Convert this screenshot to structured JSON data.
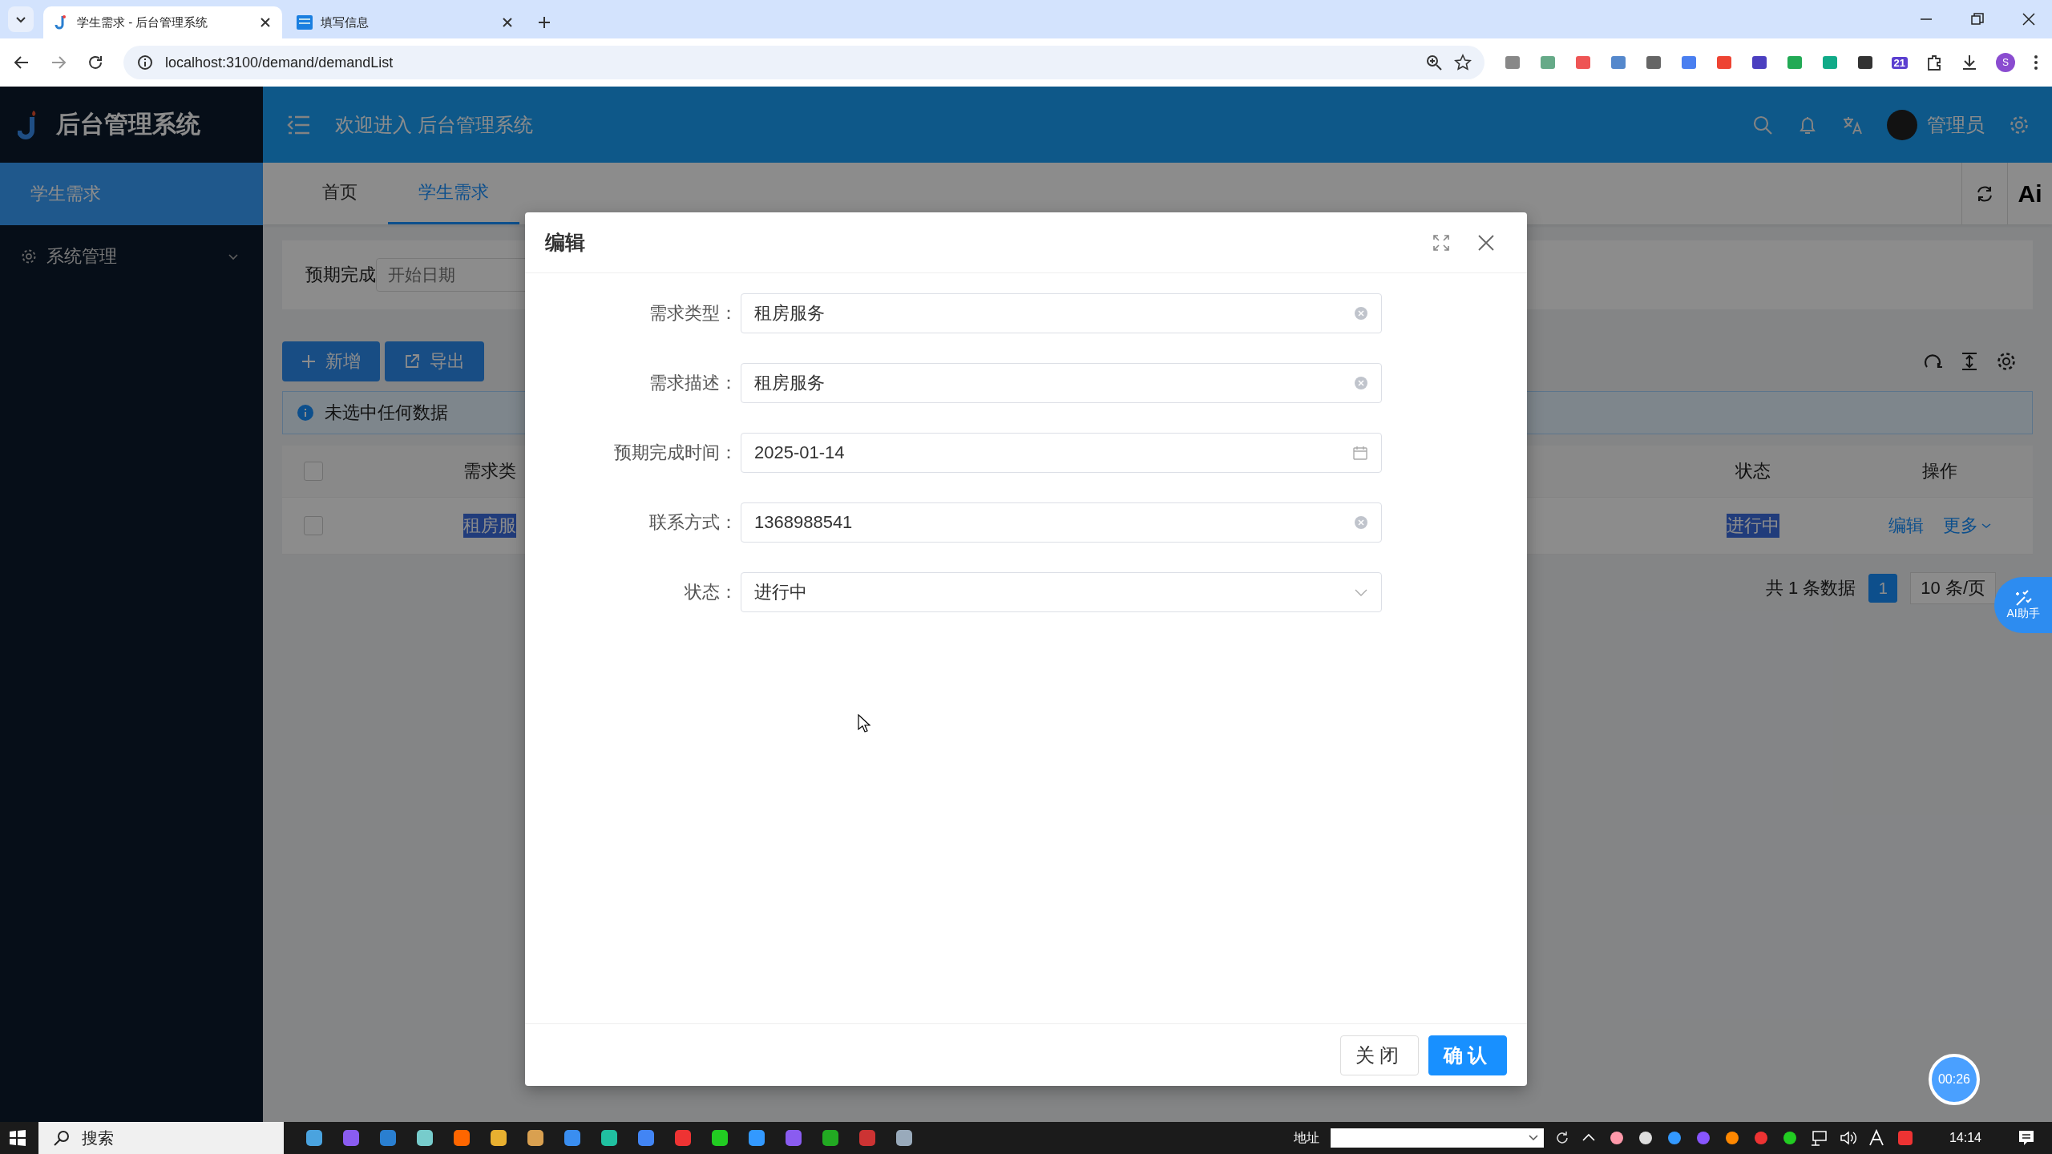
{
  "browser": {
    "tabs": [
      {
        "title": "学生需求 - 后台管理系统",
        "selected": true
      },
      {
        "title": "填写信息",
        "selected": false
      }
    ],
    "address": "localhost:3100/demand/demandList",
    "profile": "S",
    "badge": "21"
  },
  "sidebar": {
    "brand": "后台管理系统",
    "items": [
      {
        "label": "学生需求",
        "kind": "link",
        "selected": true
      },
      {
        "label": "系统管理",
        "kind": "group",
        "selected": false,
        "expanded": false
      }
    ]
  },
  "header": {
    "welcome": "欢迎进入 后台管理系统",
    "user": "管理员"
  },
  "tabs": [
    {
      "label": "首页",
      "selected": false
    },
    {
      "label": "学生需求",
      "selected": true
    }
  ],
  "tabs_extra": "Ai",
  "filter": {
    "label": "预期完成",
    "placeholder": "开始日期"
  },
  "toolbar": {
    "buttons": [
      {
        "label": "新增",
        "kind": "add"
      },
      {
        "label": "导出",
        "kind": "export"
      }
    ]
  },
  "alert": "未选中任何数据",
  "table": {
    "select_all": {
      "checked": false
    },
    "columns": [
      "需求类",
      "状态",
      "操作"
    ],
    "rows": [
      {
        "checked": false,
        "type": {
          "text": "租房服",
          "highlighted": true
        },
        "status": {
          "text": "进行中",
          "highlighted": true
        },
        "actions": [
          {
            "label": "编辑",
            "kind": "link"
          },
          {
            "label": "更多",
            "kind": "menu"
          }
        ]
      }
    ]
  },
  "pagination": {
    "total": "共 1 条数据",
    "pages": [
      {
        "label": "1",
        "selected": true
      }
    ],
    "page_size": "10 条/页"
  },
  "dialog": {
    "title": "编辑",
    "fields": [
      {
        "label": "需求类型：",
        "value": "租房服务",
        "kind": "clear"
      },
      {
        "label": "需求描述：",
        "value": "租房服务",
        "kind": "clear"
      },
      {
        "label": "预期完成时间：",
        "value": "2025-01-14",
        "kind": "date"
      },
      {
        "label": "联系方式：",
        "value": "1368988541",
        "kind": "clear"
      },
      {
        "label": "状态：",
        "value": "进行中",
        "kind": "select"
      }
    ],
    "buttons": [
      {
        "label": "关闭",
        "kind": "default"
      },
      {
        "label": "确认",
        "kind": "primary"
      }
    ]
  },
  "ai_helper": "AI助手",
  "timer": "00:26",
  "taskbar": {
    "search": "搜索",
    "address_label": "地址",
    "time": "14:14"
  }
}
